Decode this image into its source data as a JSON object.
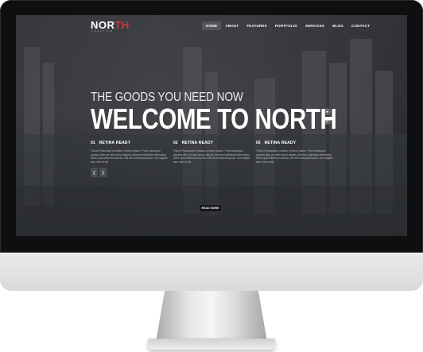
{
  "colors": {
    "accent": "#d1373c",
    "text_primary": "#ffffff",
    "text_muted": "#b7b9bc",
    "bezel": "#0e0f10",
    "chin": "#e3e4e4"
  },
  "logo": {
    "main": "NOR",
    "accent": "TH",
    "subtitle": "CREATIVE"
  },
  "nav": {
    "items": [
      {
        "label": "HOME",
        "active": true
      },
      {
        "label": "ABOUT"
      },
      {
        "label": "FEATURES"
      },
      {
        "label": "PORTFOLIO"
      },
      {
        "label": "SERVICES"
      },
      {
        "label": "BLOG"
      },
      {
        "label": "CONTACT"
      }
    ]
  },
  "hero": {
    "tagline": "THE GOODS YOU NEED NOW",
    "headline": "WELCOME TO NORTH",
    "side_icons": [
      "circle-control-icon",
      "chevron-down-circle-icon"
    ]
  },
  "features": [
    {
      "number": "01",
      "title": "RETINA READY",
      "body": "This is Photoshop's version of lorem Ipsum. Proin bibendum gravida nibh vel velit auctor aliquet. Aenean sollicitudin bibendum, lorem quis bibendum auctor, nisi elit consequat ipsum, nec sagittis sem nibh id elit."
    },
    {
      "number": "02",
      "title": "RETINA READY",
      "body": "This is Photoshop's version of lorem Ipsum. Proin bibendum gravida nibh vel velit auctor aliquet. Aenean sollicitudin bibendum, lorem quis bibendum auctor, nisi elit consequat ipsum, nec sagittis sem nibh id elit."
    },
    {
      "number": "03",
      "title": "RETINA READY",
      "body": "This is Photoshop's version of lorem Ipsum. Proin bibendum gravida nibh vel velit auctor aliquet. Aenean sollicitudin bibendum, lorem quis bibendum auctor, nisi elit consequat ipsum, nec sagittis sem nibh id elit."
    }
  ],
  "slider": {
    "prev_icon": "chevron-left-icon",
    "next_icon": "chevron-right-icon"
  },
  "read_more": {
    "label": "READ MORE"
  }
}
